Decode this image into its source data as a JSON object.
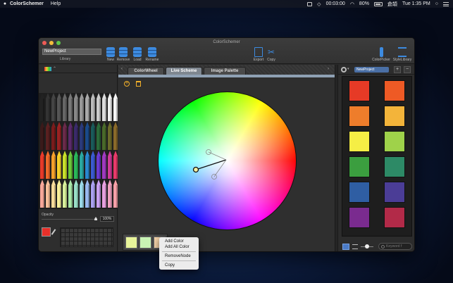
{
  "menubar": {
    "apple": "",
    "app_name": "ColorSchemer",
    "help": "Help",
    "timer": "00:03:00",
    "battery": "80%",
    "input_source": "倉頡",
    "clock": "Tue 1:35 PM"
  },
  "window": {
    "title": "ColorSchemer",
    "project_name": "NewProject",
    "library_label": "Library"
  },
  "toolbar": {
    "new": "New",
    "remove": "Remove",
    "load": "Load",
    "rename": "Rename",
    "export": "Export",
    "copy": "Copy",
    "colorpicker": "ColorPicker",
    "stylelibrary": "StyleLibrary"
  },
  "tabs": [
    {
      "label": "ColorWheel"
    },
    {
      "label": "Live Scheme"
    },
    {
      "label": "Image Palette"
    }
  ],
  "left_panel": {
    "opacity_label": "Opacity",
    "opacity_value": "100%",
    "current_color": "#e8302a"
  },
  "scheme_nodes": [
    "#e8f49a",
    "#c9f3b4",
    "#f4d2a8"
  ],
  "context_menu": {
    "items": [
      "Add Color",
      "Add All Color",
      "RemoveNode",
      "Copy"
    ]
  },
  "right_panel": {
    "project_select": "NewProject",
    "add": "+",
    "remove": "−",
    "search_placeholder": "Keyword f",
    "swatches": [
      "#e63a26",
      "#ee5a25",
      "#ee7d2b",
      "#f3b43a",
      "#f5ee45",
      "#9fd24a",
      "#3b9e3f",
      "#2d8a66",
      "#2f5ea3",
      "#4b3d96",
      "#7a2b8f",
      "#b22a48"
    ]
  },
  "colors": {
    "accent": "#3d8be0",
    "action": "#f2b02a"
  }
}
